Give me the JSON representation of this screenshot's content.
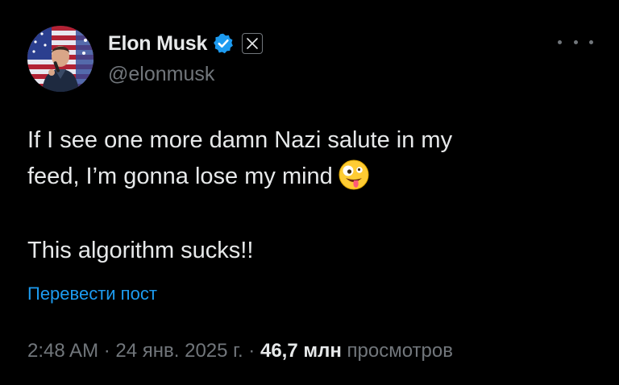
{
  "author": {
    "display_name": "Elon Musk",
    "handle": "@elonmusk",
    "verified": true,
    "affiliation_badge": "x-logo-icon"
  },
  "menu": {
    "icon": "more-horizontal-icon"
  },
  "tweet": {
    "lines": [
      "If I see one more damn Nazi salute in my",
      "feed, I’m gonna lose my mind"
    ],
    "emoji": "zany-face-icon",
    "line3": "This algorithm sucks!!"
  },
  "translate_link": "Перевести пост",
  "meta": {
    "time": "2:48 AM",
    "sep1": " · ",
    "date": "24 янв. 2025 г.",
    "sep2": " · ",
    "views_count": "46,7 млн",
    "views_label": "просмотров"
  },
  "colors": {
    "background": "#000000",
    "text_primary": "#e7e9ea",
    "text_secondary": "#71767b",
    "link": "#1d9bf0",
    "verified_badge": "#1d9bf0"
  }
}
